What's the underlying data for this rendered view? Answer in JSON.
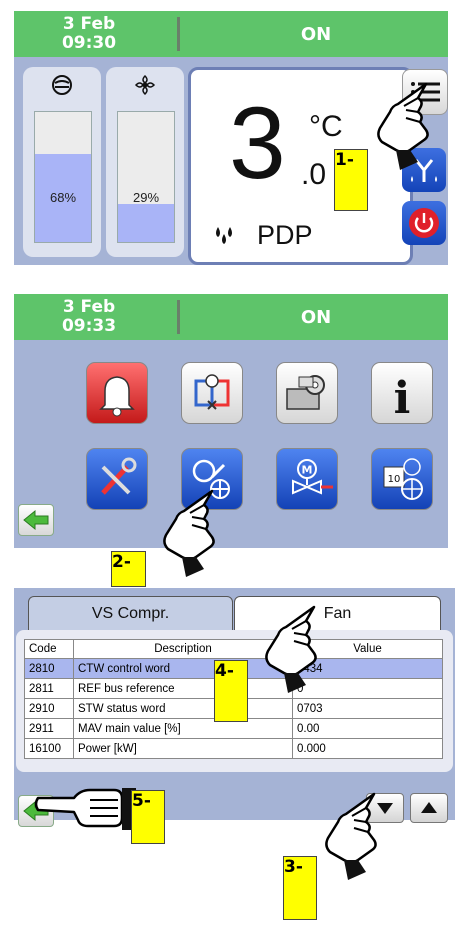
{
  "screen1": {
    "header": {
      "date": "3 Feb",
      "time": "09:30",
      "status": "ON"
    },
    "gauges": [
      {
        "icon": "compressor-icon",
        "percent_label": "68%",
        "fill": 0.68
      },
      {
        "icon": "fan-icon",
        "percent_label": "29%",
        "fill": 0.29
      }
    ],
    "display": {
      "value_int": "3",
      "value_dec": ".0",
      "unit": "°C",
      "label": "PDP"
    },
    "side_buttons": [
      "menu-icon",
      "drain-icon",
      "power-icon"
    ]
  },
  "screen2": {
    "header": {
      "date": "3 Feb",
      "time": "09:33",
      "status": "ON"
    },
    "menu_icons": [
      "alarm-bell-icon",
      "circuit-icon",
      "service-icon",
      "info-icon",
      "tools-icon",
      "compressor-fan-settings-icon",
      "motor-valve-icon",
      "calendar-network-icon"
    ]
  },
  "screen3": {
    "tabs": [
      "VS Compr.",
      "Fan"
    ],
    "active_tab": "Fan",
    "columns": [
      "Code",
      "Description",
      "Value"
    ],
    "rows": [
      {
        "code": "2810",
        "description": "CTW control word",
        "value": "0434"
      },
      {
        "code": "2811",
        "description": "REF bus reference",
        "value": "0"
      },
      {
        "code": "2910",
        "description": "STW status word",
        "value": "0703"
      },
      {
        "code": "2911",
        "description": "MAV main value [%]",
        "value": "0.00"
      },
      {
        "code": "16100",
        "description": "Power [kW]",
        "value": "0.000"
      }
    ]
  },
  "steps": [
    "1-",
    "2-",
    "3-",
    "4-",
    "5-"
  ],
  "colors": {
    "header_green": "#5ec46a",
    "panel_blue": "#a5b3d5",
    "step_yellow": "#ffff00",
    "selected_row": "#a9b6ee"
  }
}
